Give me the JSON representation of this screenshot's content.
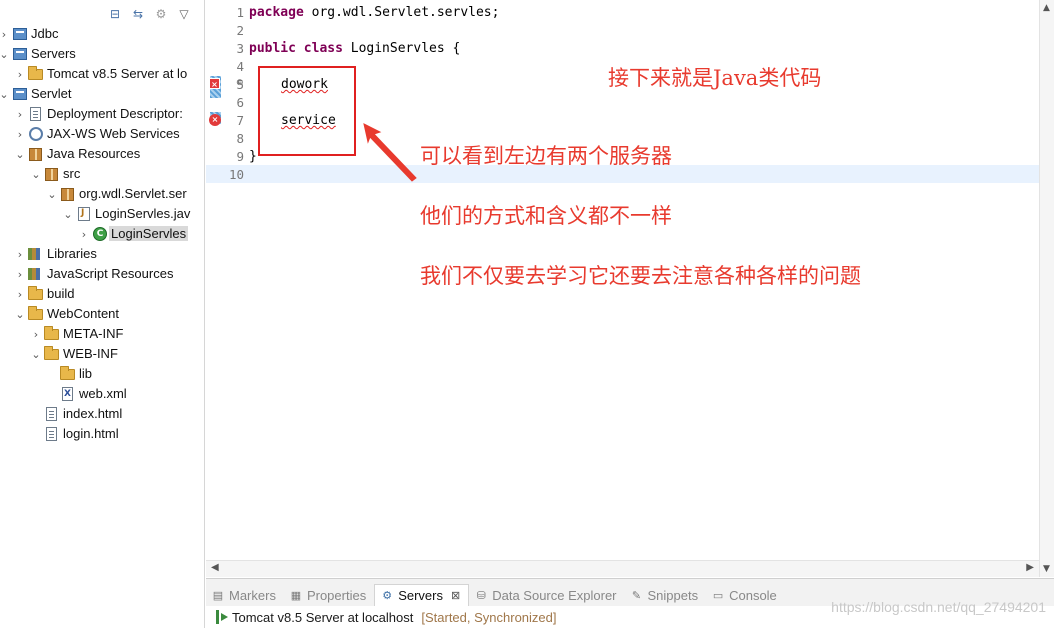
{
  "explorer": {
    "toolbar_icons": [
      "collapse-all-icon",
      "link-editor-icon",
      "filter-icon",
      "view-menu-icon"
    ],
    "items": [
      {
        "label": "Jdbc",
        "icon": "project",
        "twisty": "›"
      },
      {
        "label": "Servers",
        "icon": "project",
        "twisty": "⌄"
      },
      {
        "label": "Tomcat v8.5 Server at lo",
        "icon": "folder",
        "twisty": "›"
      },
      {
        "label": "Servlet",
        "icon": "project",
        "twisty": "⌄"
      },
      {
        "label": "Deployment Descriptor:",
        "icon": "file",
        "twisty": "›"
      },
      {
        "label": "JAX-WS Web Services",
        "icon": "gear",
        "twisty": "›"
      },
      {
        "label": "Java Resources",
        "icon": "pkg",
        "twisty": "⌄"
      },
      {
        "label": "src",
        "icon": "pkg",
        "twisty": "⌄"
      },
      {
        "label": "org.wdl.Servlet.ser",
        "icon": "pkg",
        "twisty": "⌄"
      },
      {
        "label": "LoginServles.jav",
        "icon": "java",
        "twisty": "⌄"
      },
      {
        "label": "LoginServles",
        "icon": "cls",
        "twisty": "›"
      },
      {
        "label": "Libraries",
        "icon": "lib",
        "twisty": "›"
      },
      {
        "label": "JavaScript Resources",
        "icon": "lib",
        "twisty": "›"
      },
      {
        "label": "build",
        "icon": "folder",
        "twisty": "›"
      },
      {
        "label": "WebContent",
        "icon": "folder",
        "twisty": "⌄"
      },
      {
        "label": "META-INF",
        "icon": "folder",
        "twisty": "›"
      },
      {
        "label": "WEB-INF",
        "icon": "folder",
        "twisty": "⌄"
      },
      {
        "label": "lib",
        "icon": "folder",
        "twisty": ""
      },
      {
        "label": "web.xml",
        "icon": "xml",
        "twisty": ""
      },
      {
        "label": "index.html",
        "icon": "file",
        "twisty": ""
      },
      {
        "label": "login.html",
        "icon": "file",
        "twisty": ""
      }
    ]
  },
  "editor": {
    "lines": [
      {
        "num": "1",
        "kw": "package",
        "rest": " org.wdl.Servlet.servles;"
      },
      {
        "num": "2",
        "kw": "",
        "rest": ""
      },
      {
        "num": "3",
        "kw": "public class",
        "rest": " LoginServles {"
      },
      {
        "num": "4",
        "kw": "",
        "rest": ""
      },
      {
        "num": "5",
        "kw": "",
        "rest": "dowork"
      },
      {
        "num": "6",
        "kw": "",
        "rest": ""
      },
      {
        "num": "7",
        "kw": "",
        "rest": "service"
      },
      {
        "num": "8",
        "kw": "",
        "rest": ""
      },
      {
        "num": "9",
        "kw": "",
        "rest": "}"
      },
      {
        "num": "10",
        "kw": "",
        "rest": ""
      }
    ]
  },
  "annotations": {
    "a1": "接下来就是Java类代码",
    "a2": "可以看到左边有两个服务器",
    "a3": "他们的方式和含义都不一样",
    "a4": "我们不仅要去学习它还要去注意各种各样的问题",
    "highlight_color": "#e02020",
    "text_color": "#e83a2e"
  },
  "bottom_panel": {
    "tabs": [
      {
        "label": "Markers",
        "icon": "markers-icon"
      },
      {
        "label": "Properties",
        "icon": "properties-icon"
      },
      {
        "label": "Servers",
        "icon": "servers-icon",
        "active": true
      },
      {
        "label": "Data Source Explorer",
        "icon": "database-icon"
      },
      {
        "label": "Snippets",
        "icon": "snippets-icon"
      },
      {
        "label": "Console",
        "icon": "console-icon"
      }
    ],
    "server_name": "Tomcat v8.5 Server at localhost",
    "server_status": "[Started, Synchronized]",
    "watermark": "https://blog.csdn.net/qq_27494201"
  }
}
